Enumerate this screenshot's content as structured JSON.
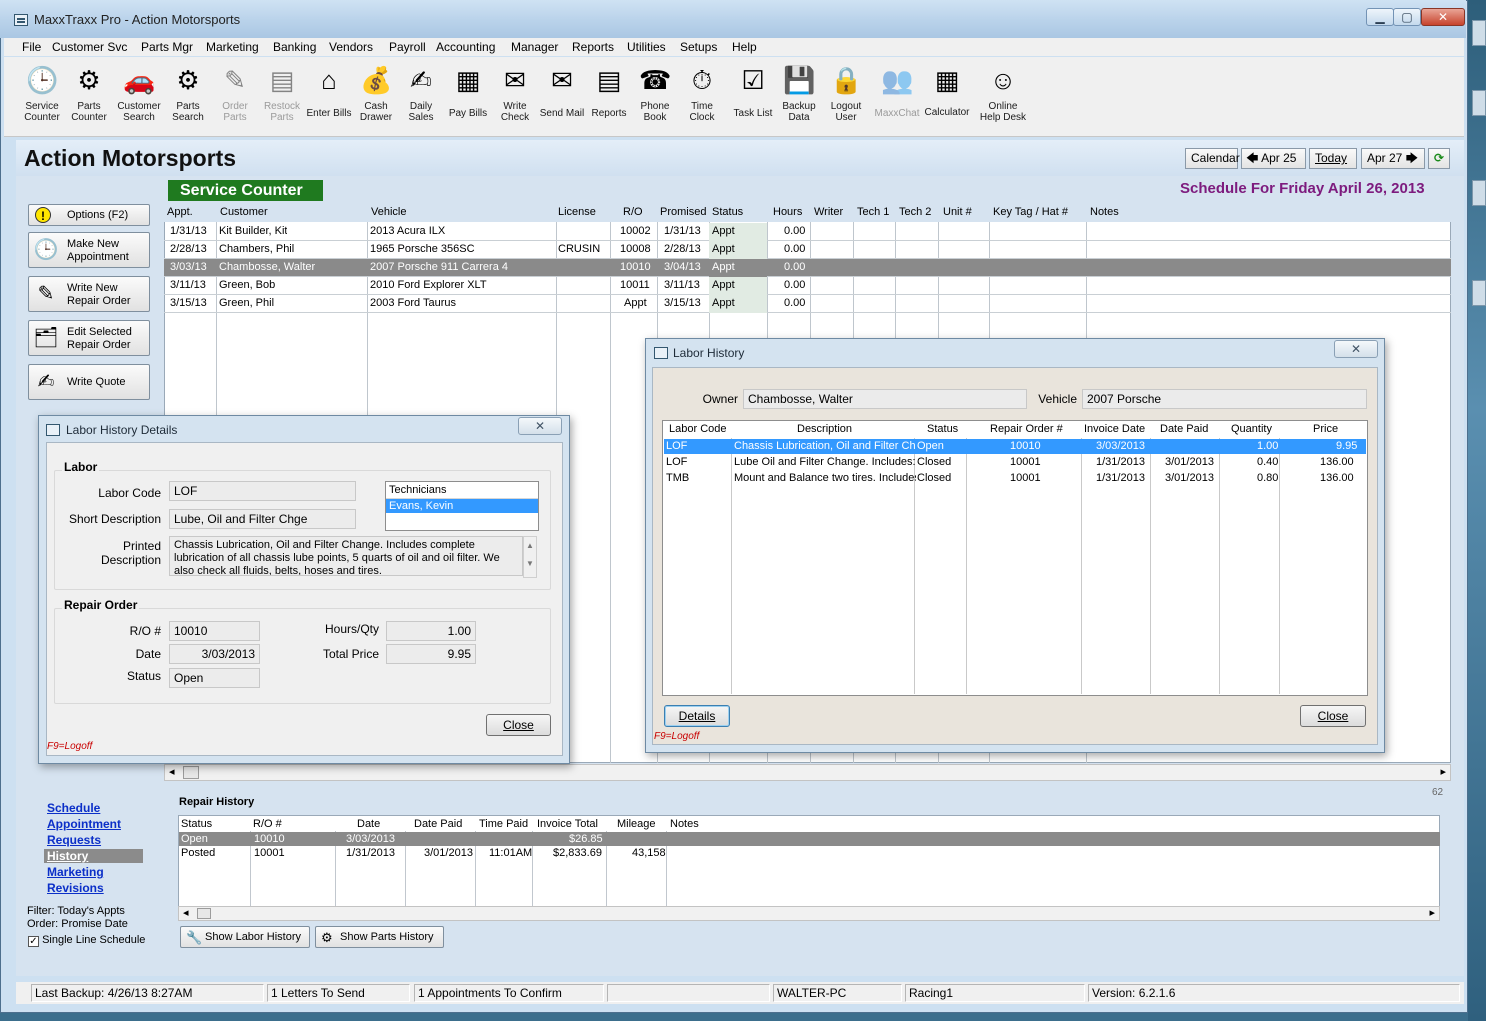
{
  "window": {
    "title": "MaxxTraxx Pro - Action Motorsports",
    "min": "▁",
    "max": "▢",
    "close": "✕"
  },
  "menu": [
    "File",
    "Customer Svc",
    "Parts Mgr",
    "Marketing",
    "Banking",
    "Vendors",
    "Payroll",
    "Accounting",
    "Manager",
    "Reports",
    "Utilities",
    "Setups",
    "Help"
  ],
  "toolbar": [
    {
      "label": "Service\nCounter",
      "icon": "clock-calendar-icon",
      "glyph": "🕒",
      "enabled": true
    },
    {
      "label": "Parts\nCounter",
      "icon": "gear-icon",
      "glyph": "⚙",
      "enabled": true
    },
    {
      "label": "Customer\nSearch",
      "icon": "car-icon",
      "glyph": "🚗",
      "enabled": true
    },
    {
      "label": "Parts\nSearch",
      "icon": "gear-search-icon",
      "glyph": "⚙",
      "enabled": true
    },
    {
      "label": "Order\nParts",
      "icon": "pen-paper-icon",
      "glyph": "✎",
      "enabled": false
    },
    {
      "label": "Restock\nParts",
      "icon": "clipboard-icon",
      "glyph": "▤",
      "enabled": false
    },
    {
      "label": "Enter Bills",
      "icon": "house-icon",
      "glyph": "⌂",
      "enabled": true
    },
    {
      "label": "Cash\nDrawer",
      "icon": "money-bag-icon",
      "glyph": "💰",
      "enabled": true
    },
    {
      "label": "Daily\nSales",
      "icon": "notepad-icon",
      "glyph": "✍",
      "enabled": true
    },
    {
      "label": "Pay Bills",
      "icon": "register-icon",
      "glyph": "▦",
      "enabled": true
    },
    {
      "label": "Write\nCheck",
      "icon": "check-icon",
      "glyph": "✉",
      "enabled": true
    },
    {
      "label": "Send Mail",
      "icon": "mailbox-icon",
      "glyph": "✉",
      "enabled": true
    },
    {
      "label": "Reports",
      "icon": "report-icon",
      "glyph": "▤",
      "enabled": true
    },
    {
      "label": "Phone\nBook",
      "icon": "phone-icon",
      "glyph": "☎",
      "enabled": true
    },
    {
      "label": "Time\nClock",
      "icon": "stopwatch-icon",
      "glyph": "⏱",
      "enabled": true
    },
    {
      "label": "Task List",
      "icon": "task-list-icon",
      "glyph": "☑",
      "enabled": true
    },
    {
      "label": "Backup\nData",
      "icon": "floppy-icon",
      "glyph": "💾",
      "enabled": true
    },
    {
      "label": "Logout\nUser",
      "icon": "padlock-icon",
      "glyph": "🔒",
      "enabled": true
    },
    {
      "label": "MaxxChat",
      "icon": "chat-people-icon",
      "glyph": "👥",
      "enabled": false
    },
    {
      "label": "Calculator",
      "icon": "calculator-icon",
      "glyph": "▦",
      "enabled": true
    },
    {
      "label": "Online\nHelp Desk",
      "icon": "headset-icon",
      "glyph": "☺",
      "enabled": true
    }
  ],
  "header": {
    "company": "Action Motorsports",
    "calendar": "Calendar",
    "prev": "Apr 25",
    "today": "Today",
    "next": "Apr 27",
    "prev_arrow": "🡄",
    "next_arrow": "🡆",
    "refresh": "⟳"
  },
  "left": {
    "buttons": [
      {
        "label": "Options (F2)",
        "glyph": "!",
        "icon": "warning-icon"
      },
      {
        "label": "Make  New\nAppointment",
        "glyph": "🕒",
        "icon": "clock-calendar-icon"
      },
      {
        "label": "Write New\nRepair Order",
        "glyph": "✎",
        "icon": "write-order-icon"
      },
      {
        "label": "Edit Selected\nRepair Order",
        "glyph": "🗂",
        "icon": "folders-icon"
      },
      {
        "label": "Write Quote",
        "glyph": "✍",
        "icon": "quote-icon"
      }
    ],
    "links": [
      "Schedule",
      "Appointment",
      "Requests",
      "History",
      "Marketing",
      "Revisions"
    ],
    "filter": "Filter: Today's Appts",
    "order": "Order: Promise Date",
    "single_line": "Single Line Schedule"
  },
  "service": {
    "tab": "Service Counter",
    "schedule_title": "Schedule For Friday  April 26, 2013",
    "columns": [
      "Appt.",
      "Customer",
      "Vehicle",
      "License",
      "R/O",
      "Promised",
      "Status",
      "Hours",
      "Writer",
      "Tech 1",
      "Tech 2",
      "Unit #",
      "Key Tag / Hat #",
      "Notes"
    ],
    "rows": [
      {
        "appt": "1/31/13",
        "customer": "Kit Builder, Kit",
        "vehicle": "2013 Acura  ILX",
        "license": "",
        "ro": "10002",
        "promised": "1/31/13",
        "status": "Appt",
        "hours": "0.00"
      },
      {
        "appt": "2/28/13",
        "customer": "Chambers, Phil",
        "vehicle": "1965 Porsche  356SC",
        "license": "CRUSIN",
        "ro": "10008",
        "promised": "2/28/13",
        "status": "Appt",
        "hours": "0.00"
      },
      {
        "appt": "3/03/13",
        "customer": "Chambosse, Walter",
        "vehicle": "2007 Porsche  911 Carrera 4",
        "license": "",
        "ro": "10010",
        "promised": "3/04/13",
        "status": "Appt",
        "hours": "0.00"
      },
      {
        "appt": "3/11/13",
        "customer": "Green, Bob",
        "vehicle": "2010 Ford  Explorer XLT",
        "license": "",
        "ro": "10011",
        "promised": "3/11/13",
        "status": "Appt",
        "hours": "0.00"
      },
      {
        "appt": "3/15/13",
        "customer": "Green, Phil",
        "vehicle": "2003 Ford  Taurus",
        "license": "",
        "ro": "Appt",
        "promised": "3/15/13",
        "status": "Appt",
        "hours": "0.00"
      }
    ],
    "scroll_left": "◂",
    "scroll_right": "▸"
  },
  "repair_history": {
    "title": "Repair History",
    "count": "62",
    "columns": [
      "Status",
      "R/O #",
      "Date",
      "Date Paid",
      "Time Paid",
      "Invoice Total",
      "Mileage",
      "Notes"
    ],
    "rows": [
      {
        "status": "Open",
        "ro": "10010",
        "date": "3/03/2013",
        "date_paid": "",
        "time_paid": "",
        "total": "$26.85",
        "mileage": ""
      },
      {
        "status": "Posted",
        "ro": "10001",
        "date": "1/31/2013",
        "date_paid": "3/01/2013",
        "time_paid": "11:01AM",
        "total": "$2,833.69",
        "mileage": "43,158"
      }
    ],
    "show_labor": "Show Labor History",
    "show_parts": "Show Parts History"
  },
  "statusbar": [
    "Last Backup:  4/26/13   8:27AM",
    "1 Letters To Send",
    "1 Appointments To Confirm",
    "",
    "WALTER-PC",
    "Racing1",
    "Version:  6.2.1.6"
  ],
  "labor_details": {
    "title": "Labor History Details",
    "close_x": "✕",
    "labor_group": "Labor",
    "labor_code_label": "Labor Code",
    "labor_code": "LOF",
    "short_desc_label": "Short Description",
    "short_desc": "Lube, Oil and Filter Chge",
    "printed_desc_label": "Printed Description",
    "printed_desc": "Chassis Lubrication, Oil and Filter Change.  Includes complete lubrication of all chassis lube points, 5 quarts of oil and oil filter.  We also check all fluids, belts, hoses and tires.",
    "technicians": [
      "Technicians",
      "Evans, Kevin"
    ],
    "ro_group": "Repair Order",
    "ro_label": "R/O #",
    "ro": "10010",
    "date_label": "Date",
    "date": "3/03/2013",
    "status_label": "Status",
    "status": "Open",
    "hours_label": "Hours/Qty",
    "hours": "1.00",
    "total_label": "Total Price",
    "total": "9.95",
    "close": "Close",
    "f9": "F9=Logoff"
  },
  "labor_history": {
    "title": "Labor History",
    "close_x": "✕",
    "owner_label": "Owner",
    "owner": "Chambosse, Walter",
    "vehicle_label": "Vehicle",
    "vehicle": "2007 Porsche",
    "columns": [
      "Labor Code",
      "Description",
      "Status",
      "Repair Order #",
      "Invoice Date",
      "Date Paid",
      "Quantity",
      "Price"
    ],
    "rows": [
      {
        "code": "LOF",
        "desc": "Chassis Lubrication, Oil and Filter Change.",
        "status": "Open",
        "ro": "10010",
        "inv": "3/03/2013",
        "paid": "",
        "qty": "1.00",
        "price": "9.95"
      },
      {
        "code": "LOF",
        "desc": "Lube Oil and Filter Change.  Includes:",
        "status": "Closed",
        "ro": "10001",
        "inv": "1/31/2013",
        "paid": "3/01/2013",
        "qty": "0.40",
        "price": "136.00"
      },
      {
        "code": "TMB",
        "desc": "Mount and Balance two tires.  Includes:",
        "status": "Closed",
        "ro": "10001",
        "inv": "1/31/2013",
        "paid": "3/01/2013",
        "qty": "0.80",
        "price": "136.00"
      }
    ],
    "details": "Details",
    "close": "Close",
    "f9": "F9=Logoff"
  },
  "colors": {
    "title_purple": "#7d1b7e",
    "service_green": "#1f7a1f",
    "link_blue": "#0b2fc8",
    "select_blue": "#3399ff",
    "f9_red": "#c80000"
  }
}
